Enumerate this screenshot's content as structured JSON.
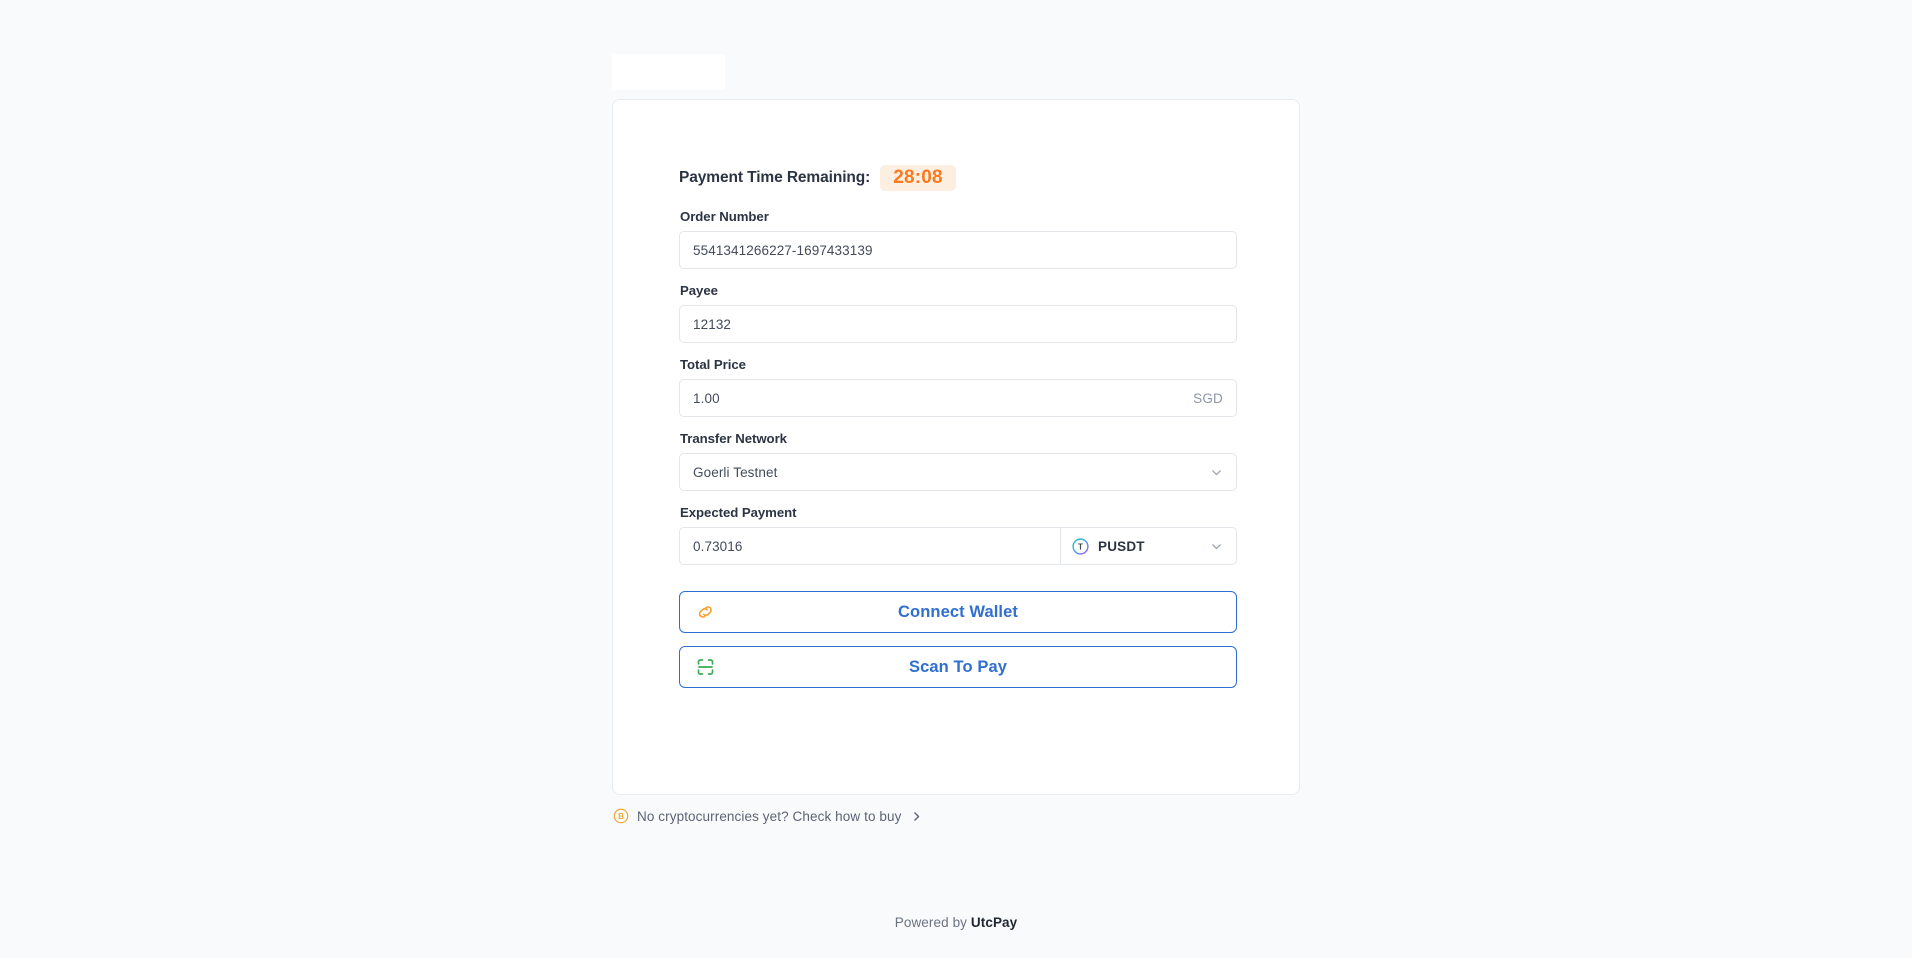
{
  "page": {
    "background_color": "#f9fafb",
    "accent_blue": "#2f6fd0",
    "accent_orange": "#f97a1f",
    "accent_green": "#3faa55"
  },
  "timer": {
    "label": "Payment Time Remaining:",
    "value": "28:08"
  },
  "fields": {
    "order_number": {
      "label": "Order Number",
      "value": "5541341266227-1697433139"
    },
    "payee": {
      "label": "Payee",
      "value": "12132"
    },
    "total_price": {
      "label": "Total Price",
      "value": "1.00",
      "currency": "SGD"
    },
    "transfer_network": {
      "label": "Transfer Network",
      "value": "Goerli Testnet",
      "chevron_icon": "chevron-down-icon"
    },
    "expected_payment": {
      "label": "Expected Payment",
      "amount": "0.73016",
      "token": "PUSDT",
      "token_icon": "tether-token-icon",
      "chevron_icon": "chevron-down-icon"
    }
  },
  "actions": {
    "connect_wallet": {
      "label": "Connect Wallet",
      "icon": "link-icon"
    },
    "scan_to_pay": {
      "label": "Scan To Pay",
      "icon": "scan-icon"
    }
  },
  "buy_crypto": {
    "icon": "bitcoin-icon",
    "text": "No cryptocurrencies yet? Check how to buy",
    "chevron_icon": "chevron-right-icon"
  },
  "footer": {
    "prefix": "Powered by ",
    "brand": "UtcPay"
  }
}
